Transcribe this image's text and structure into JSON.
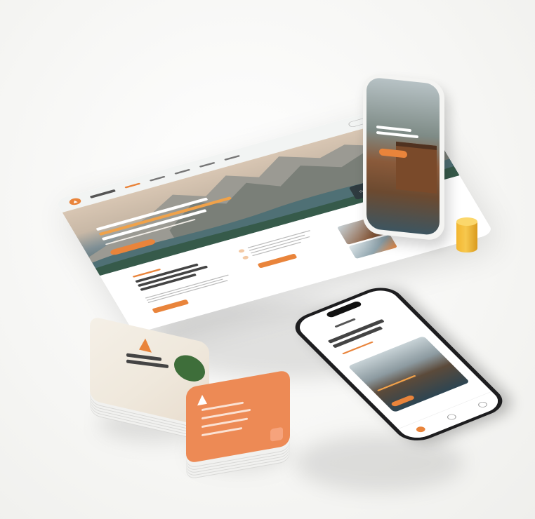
{
  "colors": {
    "accent": "#e9843b",
    "accent_soft": "#ed8a55",
    "yellow": "#f3b630",
    "dark": "#2f3b40"
  },
  "desktop": {
    "icons": [
      "logo-icon",
      "search-icon",
      "mountain-hero-icon",
      "calendar-icon",
      "location-icon",
      "user-icon"
    ]
  },
  "phone": {
    "icons": [
      "home-icon",
      "explore-icon",
      "profile-icon"
    ]
  },
  "cards": {
    "icons": [
      "logo-icon",
      "list-icon"
    ]
  }
}
